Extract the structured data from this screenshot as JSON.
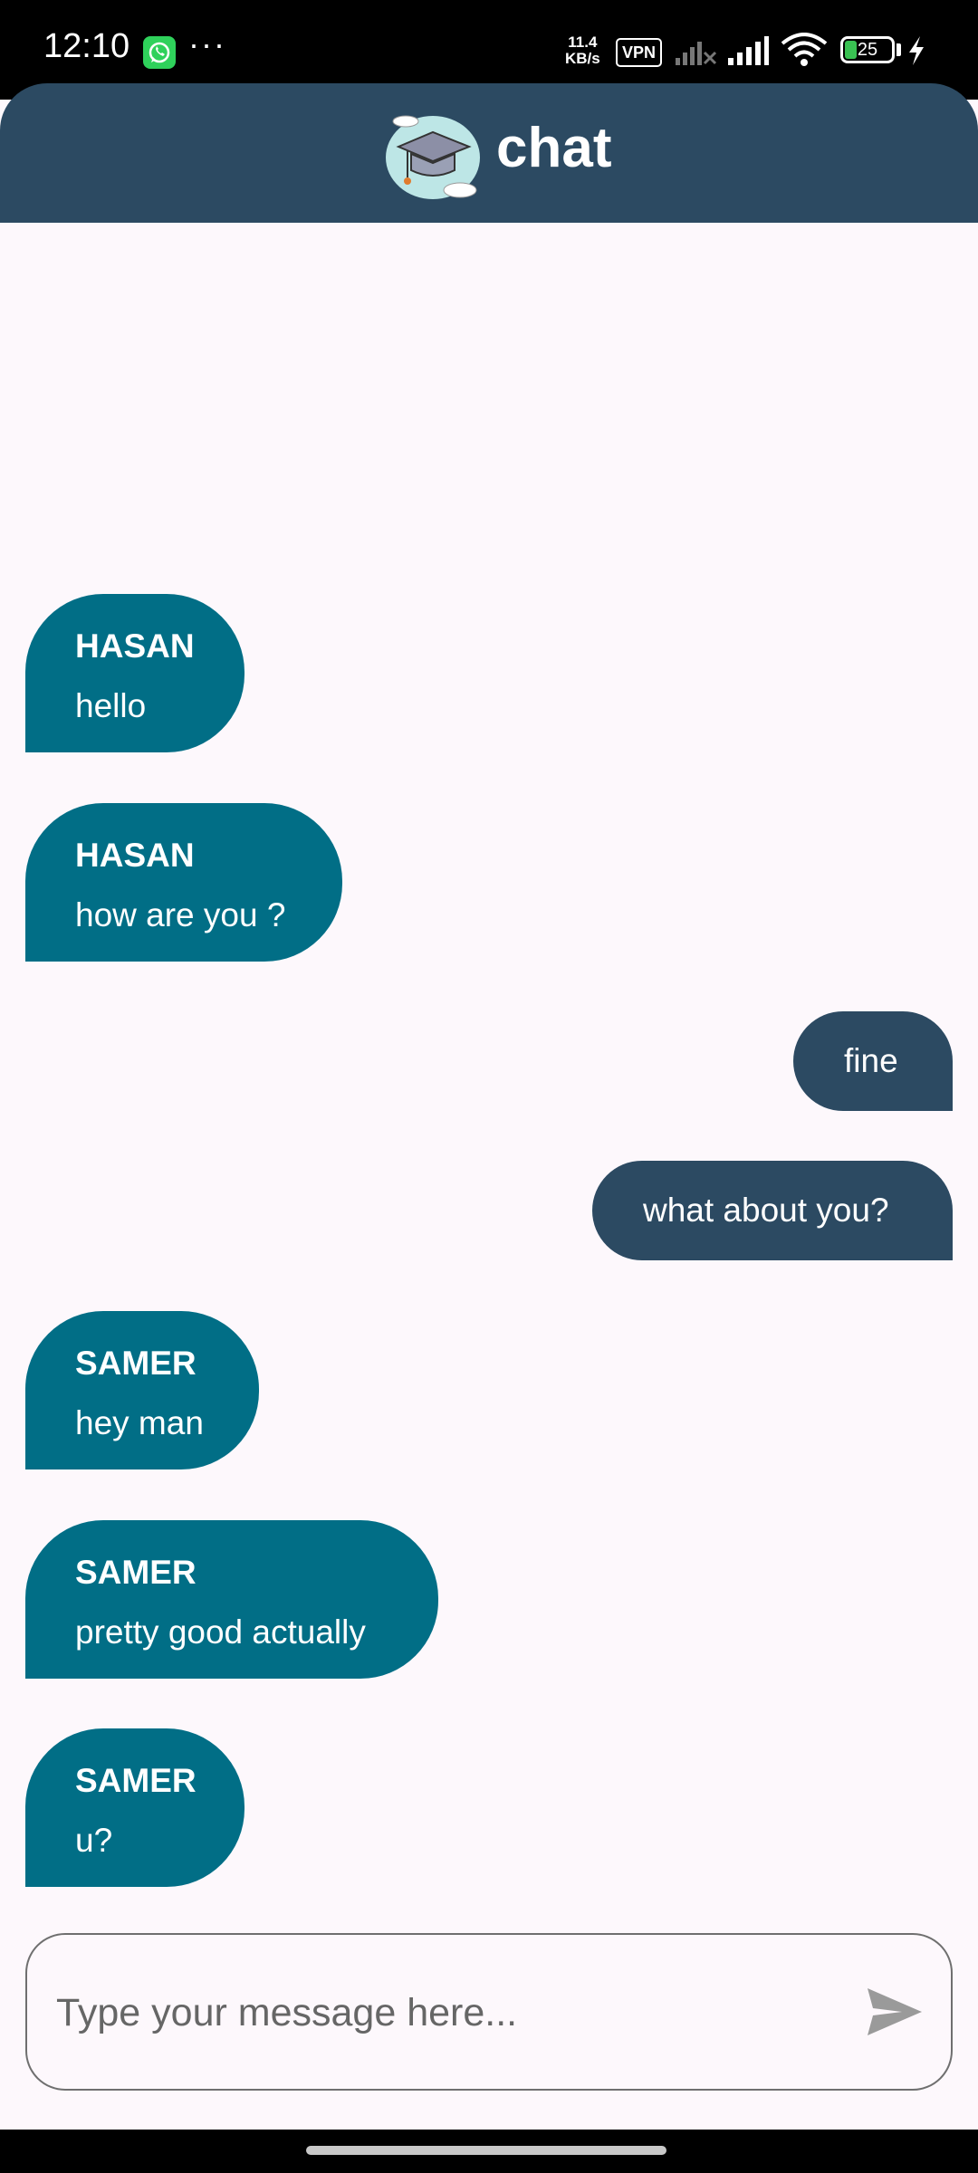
{
  "status_bar": {
    "time": "12:10",
    "dots": "···",
    "net_speed_value": "11.4",
    "net_speed_unit": "KB/s",
    "vpn": "VPN",
    "battery": "25",
    "icons": [
      "whatsapp-icon",
      "signal-off-icon",
      "signal-icon",
      "wifi-icon",
      "battery-icon",
      "charging-icon"
    ]
  },
  "header": {
    "title": "chat",
    "logo": "graduation-cap-logo",
    "color": "#2c4a62"
  },
  "messages": [
    {
      "direction": "in",
      "sender": "HASAN",
      "text": "hello"
    },
    {
      "direction": "in",
      "sender": "HASAN",
      "text": "how are you ?"
    },
    {
      "direction": "out",
      "text": "fine"
    },
    {
      "direction": "out",
      "text": "what about you?"
    },
    {
      "direction": "in",
      "sender": "SAMER",
      "text": "hey man"
    },
    {
      "direction": "in",
      "sender": "SAMER",
      "text": "pretty good actually"
    },
    {
      "direction": "in",
      "sender": "SAMER",
      "text": "u?"
    }
  ],
  "colors": {
    "incoming_bubble": "#016e86",
    "outgoing_bubble": "#2c4a62",
    "background": "#fdf8fc"
  },
  "composer": {
    "placeholder": "Type your message here...",
    "value": "",
    "send_icon": "send-icon"
  }
}
